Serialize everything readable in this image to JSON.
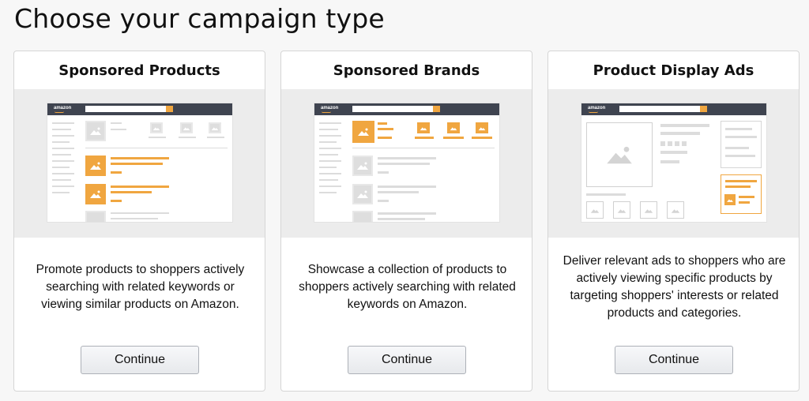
{
  "page": {
    "title": "Choose your campaign type"
  },
  "cards": [
    {
      "title": "Sponsored Products",
      "description": "Promote products to shoppers actively searching with related keywords or viewing similar products on Amazon.",
      "button_label": "Continue"
    },
    {
      "title": "Sponsored Brands",
      "description": "Showcase a collection of products to shoppers actively searching with related keywords on Amazon.",
      "button_label": "Continue"
    },
    {
      "title": "Product Display Ads",
      "description": "Deliver relevant ads to shoppers who are actively viewing specific products by targeting shoppers' interests or related products and categories.",
      "button_label": "Continue"
    }
  ],
  "mockup": {
    "logo_text": "amazon"
  },
  "colors": {
    "accent_orange": "#f0a640",
    "mock_header": "#3f4450",
    "placeholder_gray": "#dedede"
  },
  "icons": [
    "image-placeholder-icon"
  ]
}
